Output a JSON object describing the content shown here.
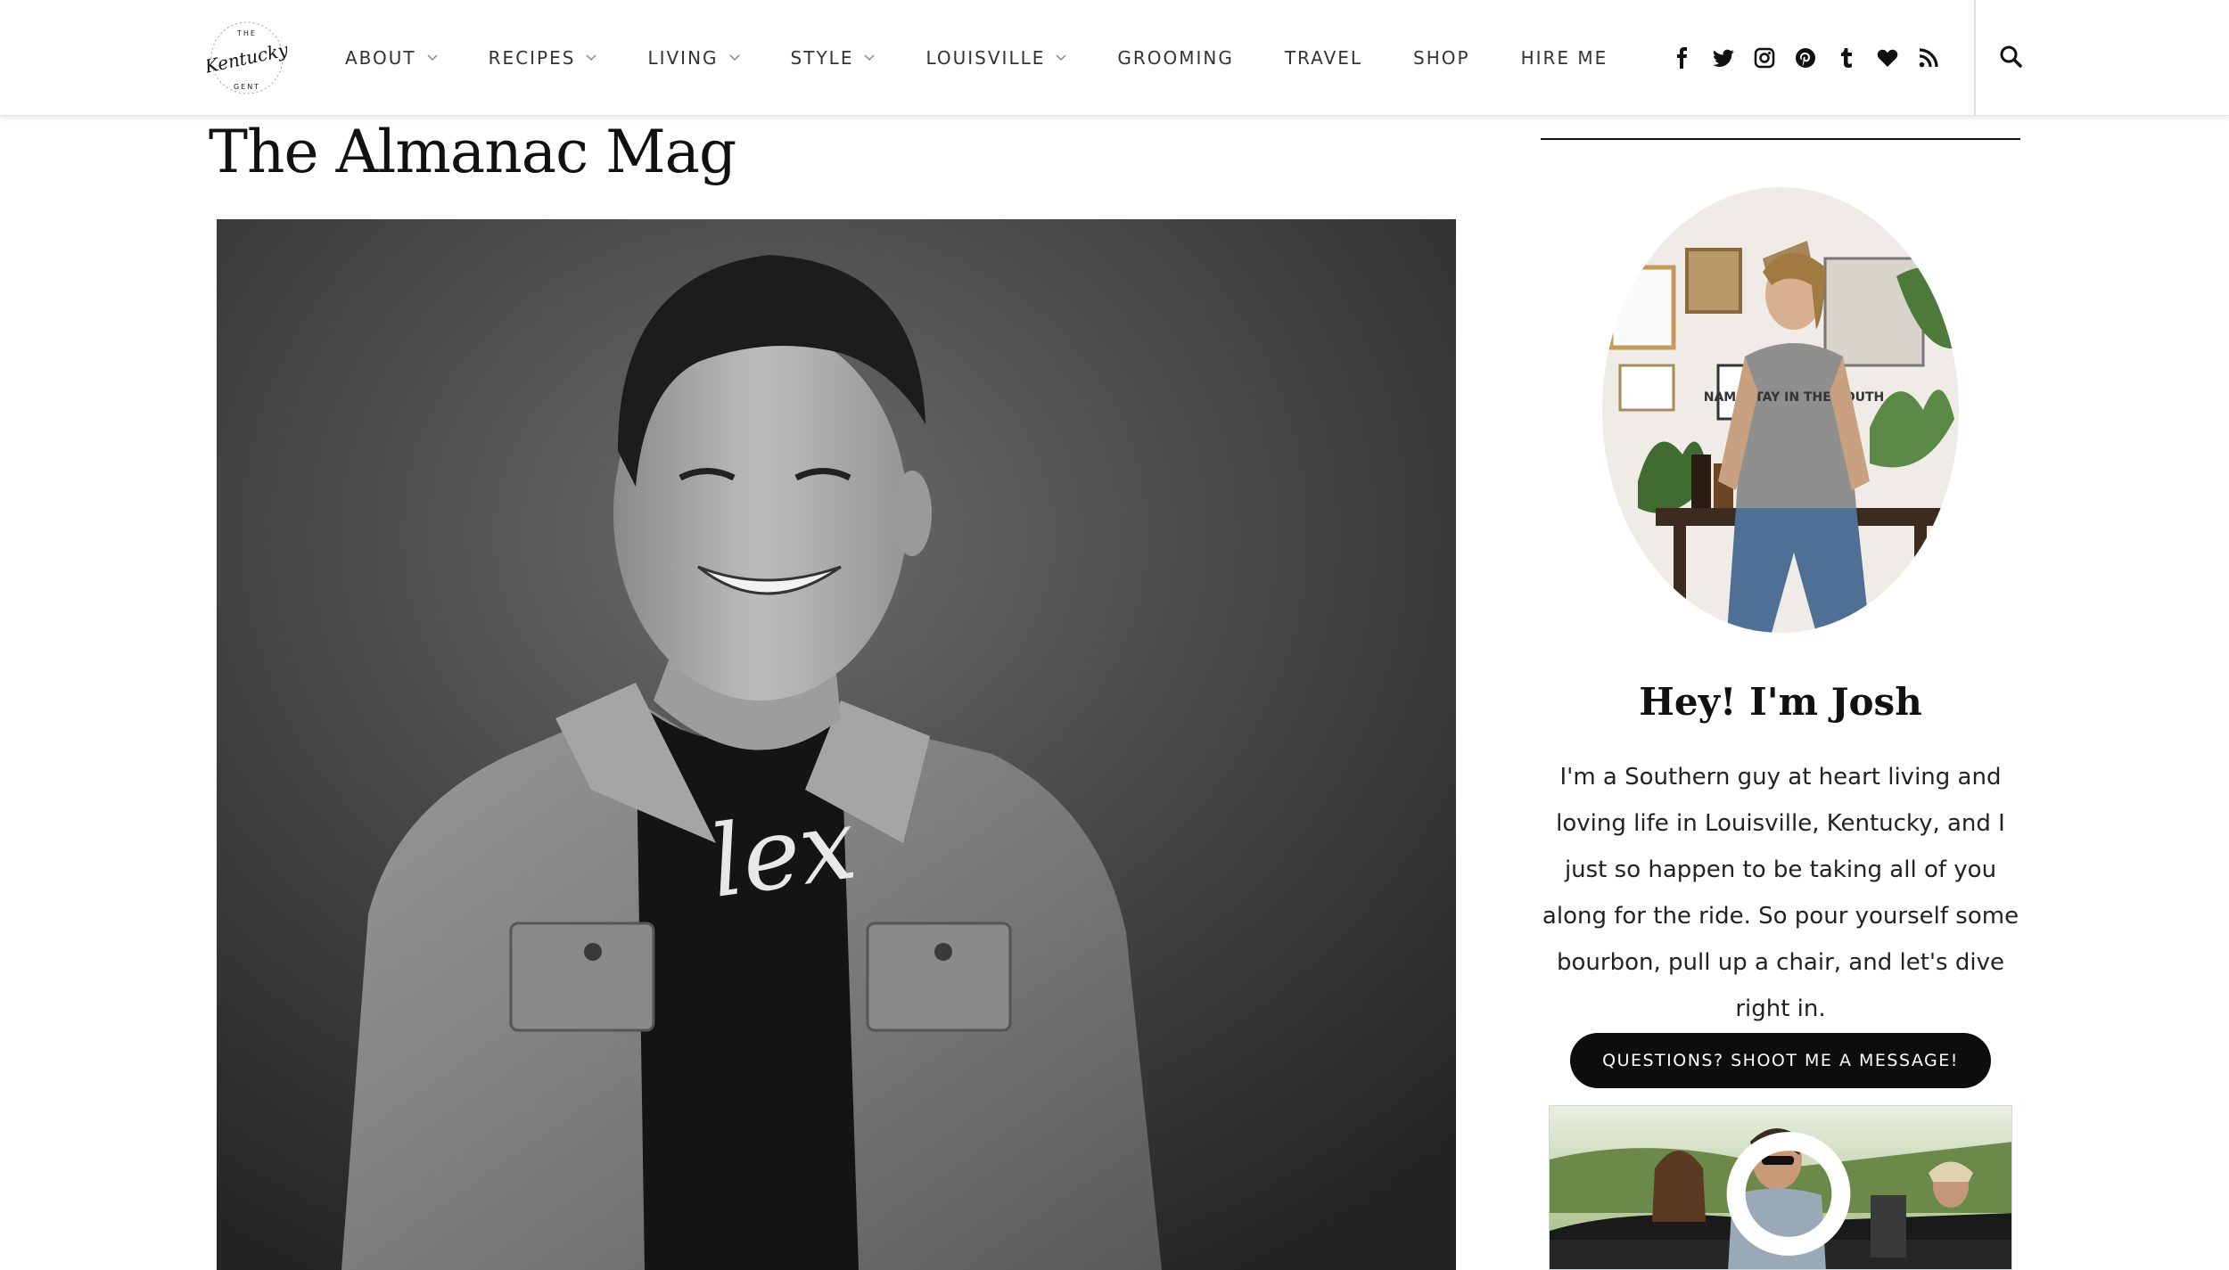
{
  "brand": {
    "logo_word": "Kentucky",
    "logo_top": "THE",
    "logo_bottom": "GENT"
  },
  "nav": {
    "items": [
      {
        "label": "ABOUT",
        "has_dropdown": true
      },
      {
        "label": "RECIPES",
        "has_dropdown": true
      },
      {
        "label": "LIVING",
        "has_dropdown": true
      },
      {
        "label": "STYLE",
        "has_dropdown": true
      },
      {
        "label": "LOUISVILLE",
        "has_dropdown": true
      },
      {
        "label": "GROOMING",
        "has_dropdown": false
      },
      {
        "label": "TRAVEL",
        "has_dropdown": false
      },
      {
        "label": "SHOP",
        "has_dropdown": false
      },
      {
        "label": "HIRE ME",
        "has_dropdown": false
      }
    ]
  },
  "social": [
    "facebook-icon",
    "twitter-icon",
    "instagram-icon",
    "pinterest-icon",
    "tumblr-icon",
    "heart-icon",
    "rss-icon"
  ],
  "page": {
    "title": "The Almanac Mag"
  },
  "sidebar": {
    "greeting": "Hey! I'm Josh",
    "bio": "I'm a Southern guy at heart living and loving life in Louisville, Kentucky, and I just so happen to be taking all of you along for the ride. So pour yourself some bourbon, pull up a chair, and let's dive right in.",
    "cta_label": "QUESTIONS? SHOOT ME A MESSAGE!",
    "shirt_text": "NAMASTAY IN THE SOUTH"
  },
  "hero_shirt_text": "lex",
  "colors": {
    "text": "#111111",
    "cta_bg": "#0d0d0d",
    "header_border": "#e2e2e2"
  }
}
